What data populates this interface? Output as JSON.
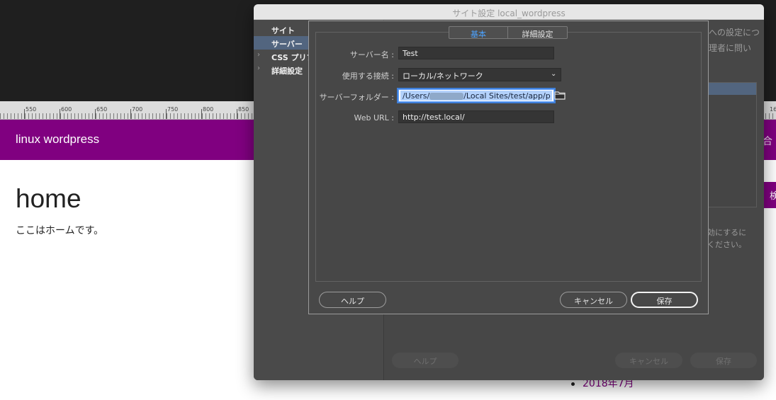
{
  "ruler": {
    "labels": [
      "550",
      "600",
      "650",
      "700",
      "750",
      "800",
      "850"
    ],
    "right_label": "16"
  },
  "page": {
    "site_title": "linux wordpress",
    "heading": "home",
    "text": "ここはホームです。",
    "right_tab_1": "合",
    "right_tab_2": "検",
    "archive_item": "2018年7月"
  },
  "outer_dialog": {
    "title": "サイト設定 local_wordpress",
    "sidebar": {
      "items": [
        {
          "label": "サイト",
          "selected": false,
          "expandable": false
        },
        {
          "label": "サーバー",
          "selected": true,
          "expandable": false
        },
        {
          "label": "CSS プリプ",
          "selected": false,
          "expandable": true
        },
        {
          "label": "詳細設定",
          "selected": false,
          "expandable": true
        }
      ]
    },
    "background_text": {
      "line1": "への設定につ",
      "line2": "理者に問い",
      "line3": "効にするに",
      "line4": "ください。"
    },
    "buttons": {
      "help": "ヘルプ",
      "cancel": "キャンセル",
      "save": "保存"
    }
  },
  "server_dialog": {
    "tabs": [
      "基本",
      "詳細設定"
    ],
    "active_tab": "基本",
    "fields": {
      "server_name": {
        "label": "サーバー名 :",
        "value": "Test"
      },
      "connection": {
        "label": "使用する接続 :",
        "value": "ローカル/ネットワーク"
      },
      "server_folder": {
        "label": "サーバーフォルダー :",
        "value_prefix": "/Users/",
        "value_suffix": "/Local Sites/test/app/p"
      },
      "web_url": {
        "label": "Web URL :",
        "value": "http://test.local/"
      }
    },
    "buttons": {
      "help": "ヘルプ",
      "cancel": "キャンセル",
      "save": "保存"
    }
  },
  "colors": {
    "brand_purple": "#800080",
    "selection_blue": "#52657f",
    "active_tab": "#4da3ff",
    "focus_ring": "#3f7fd9"
  },
  "icons": [
    "chevron-right-icon",
    "chevron-down-icon",
    "folder-icon"
  ]
}
